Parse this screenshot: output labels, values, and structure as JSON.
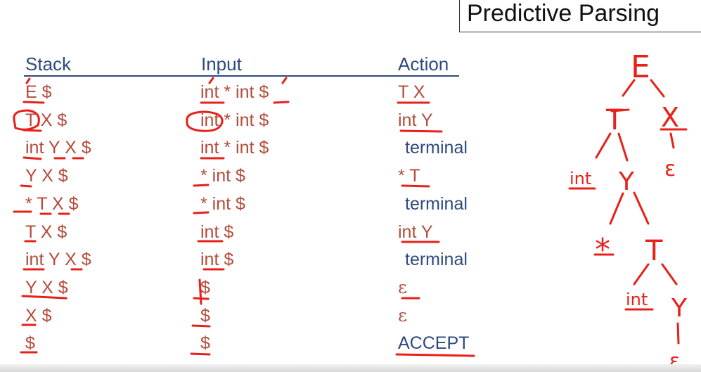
{
  "title": "Predictive Parsing",
  "headers": {
    "stack": "Stack",
    "input": "Input",
    "action": "Action"
  },
  "rows": [
    {
      "stack": "E $",
      "input": "int * int $",
      "action": "T X",
      "action_type": "production"
    },
    {
      "stack": "T X $",
      "input": "int * int $",
      "action": "int Y",
      "action_type": "production"
    },
    {
      "stack": "int Y X $",
      "input": "int * int $",
      "action": "terminal",
      "action_type": "terminal"
    },
    {
      "stack": "Y X $",
      "input": "* int $",
      "action": "* T",
      "action_type": "production"
    },
    {
      "stack": "* T X $",
      "input": "* int $",
      "action": "terminal",
      "action_type": "terminal"
    },
    {
      "stack": "T X $",
      "input": "int $",
      "action": "int Y",
      "action_type": "production"
    },
    {
      "stack": "int Y X $",
      "input": "int $",
      "action": "terminal",
      "action_type": "terminal"
    },
    {
      "stack": "Y X $",
      "input": "$",
      "action": "ε",
      "action_type": "epsilon"
    },
    {
      "stack": "X $",
      "input": "$",
      "action": "ε",
      "action_type": "epsilon"
    },
    {
      "stack": "$",
      "input": "$",
      "action": "ACCEPT",
      "action_type": "terminal"
    }
  ],
  "parse_tree_labels": {
    "root": "E",
    "t1": "T",
    "x1": "X",
    "x1_child": "ε",
    "int1": "int",
    "y1": "Y",
    "star": "*",
    "t2": "T",
    "int2": "int",
    "y2": "Y",
    "y2_child": "ε"
  },
  "colors": {
    "ink": "#e8201a",
    "header": "#2e4a7e",
    "production": "#b34c3b"
  }
}
